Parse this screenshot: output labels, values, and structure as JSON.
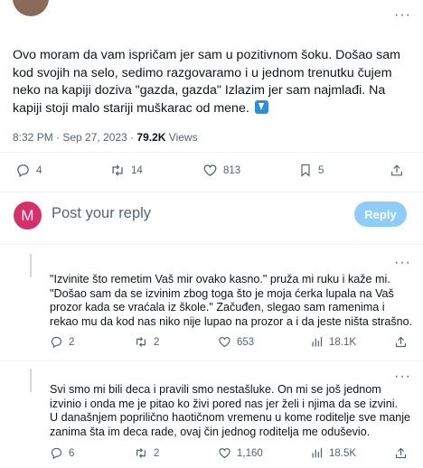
{
  "main_tweet": {
    "text": "Ovo moram da vam ispričam jer sam u pozitivnom šoku. Došao sam kod svojih na selo, sedimo razgovaramo i u jednom trenutku čujem neko na kapiji doziva \"gazda, gazda\" Izlazim jer sam najmlađi. Na kapiji stoji malo stariji muškarac od mene.",
    "time": "8:32 PM · Sep 27, 2023 · ",
    "views_count": "79.2K",
    "views_label": " Views",
    "replies": "4",
    "retweets": "14",
    "likes": "813",
    "bookmarks": "5"
  },
  "reply_composer": {
    "avatar_letter": "M",
    "placeholder": "Post your reply",
    "button_label": "Reply"
  },
  "replies": [
    {
      "text": "\"Izvinite što remetim Vaš mir ovako kasno.\" pruža mi ruku i kaže mi. \"Došao sam da se izvinim zbog toga što je moja ćerka lupala na Vaš prozor kada se vraćala iz škole.\" Začuđen, slegao sam ramenima i rekao mu da kod nas niko nije lupao na prozor a i da jeste ništa strašno.",
      "replies": "2",
      "retweets": "2",
      "likes": "653",
      "views": "18.1K"
    },
    {
      "text": "Svi smo mi bili deca i pravili smo nestašluke. On mi se još jednom izvinio i onda me je pitao ko živi pored nas jer želi i njima da se izvini.\nU današnjem poprilično haotičnom vremenu u kome roditelje sve manje zanima šta im deca rade, ovaj čin jednog roditelja me oduševio.",
      "replies": "6",
      "retweets": "2",
      "likes": "1,160",
      "views": "18.5K"
    }
  ],
  "icons": [
    "more-icon",
    "reply-icon",
    "retweet-icon",
    "like-icon",
    "bookmark-icon",
    "share-icon",
    "views-icon",
    "arrow-down-emoji-icon"
  ],
  "colors": {
    "accent": "#1d9bf0",
    "reply_button": "#8ecdf8",
    "avatar": "#d6306a",
    "muted": "#536471"
  }
}
